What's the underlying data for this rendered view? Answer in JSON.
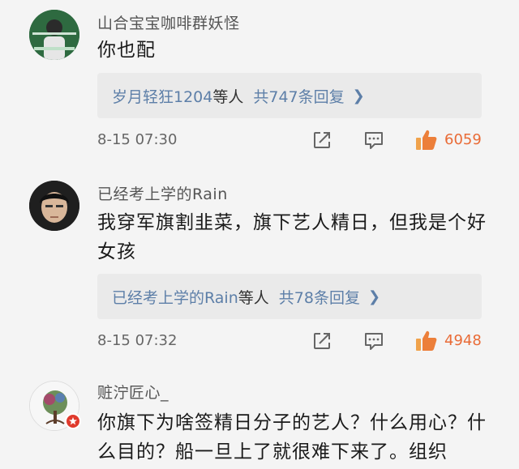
{
  "comments": [
    {
      "username": "山合宝宝咖啡群妖怪",
      "text": "你也配",
      "reply_users": "岁月轻狂1204",
      "reply_users_suffix": "等人",
      "reply_count": "共747条回复",
      "time": "8-15 07:30",
      "likes": "6059"
    },
    {
      "username": "已经考上学的Rain",
      "text": "我穿军旗割韭菜，旗下艺人精日，但我是个好女孩",
      "reply_users": "已经考上学的Rain",
      "reply_users_suffix": "等人",
      "reply_count": "共78条回复",
      "time": "8-15 07:32",
      "likes": "4948"
    },
    {
      "username": "赃泞匠心_",
      "text": "你旗下为啥签精日分子的艺人？什么用心？什么目的？船一旦上了就很难下来了。组织"
    }
  ],
  "colors": {
    "link": "#5d7fa8",
    "like": "#e96b36",
    "background": "#f4f4f4",
    "reply_box": "#eaeaea"
  },
  "icons": {
    "share": "share-icon",
    "comment": "comment-icon",
    "like": "thumbs-up-icon",
    "chevron": "chevron-right-icon"
  }
}
